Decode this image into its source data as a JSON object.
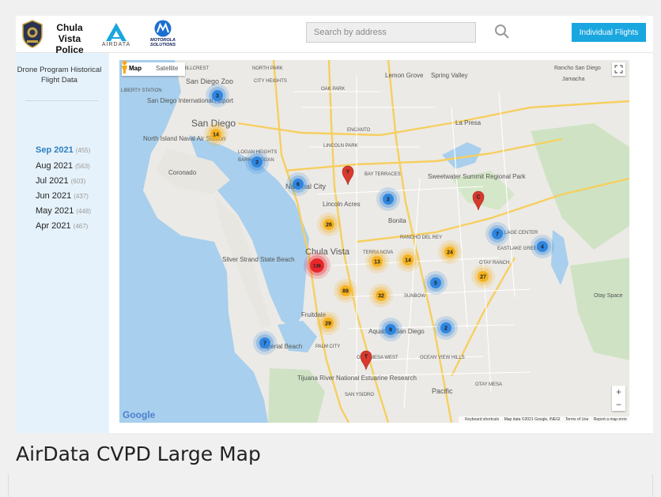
{
  "header": {
    "police_name": "Chula Vista Police",
    "airdata_label": "AIRDATA",
    "moto_label": "MOTOROLA SOLUTIONS",
    "search_placeholder": "Search by address",
    "flights_button": "Individual Flights"
  },
  "sidebar": {
    "title": "Drone Program Historical Flight Data",
    "months": [
      {
        "label": "Sep 2021",
        "count": "(455)",
        "active": true
      },
      {
        "label": "Aug 2021",
        "count": "(563)",
        "active": false
      },
      {
        "label": "Jul 2021",
        "count": "(603)",
        "active": false
      },
      {
        "label": "Jun 2021",
        "count": "(437)",
        "active": false
      },
      {
        "label": "May 2021",
        "count": "(448)",
        "active": false
      },
      {
        "label": "Apr 2021",
        "count": "(467)",
        "active": false
      }
    ]
  },
  "map": {
    "type_map": "Map",
    "type_satellite": "Satellite",
    "google": "Google",
    "attribution": [
      "Keyboard shortcuts",
      "Map data ©2021 Google, INEGI",
      "Terms of Use",
      "Report a map error"
    ],
    "places": [
      "HILLCREST",
      "NORTH PARK",
      "CITY HEIGHTS",
      "OAK PARK",
      "Lemon Grove",
      "Spring Valley",
      "Rancho San Diego",
      "Jamacha",
      "San Diego Zoo",
      "San Diego International Airport",
      "LIBERTY STATION",
      "San Diego",
      "ENCANTO",
      "La Presa",
      "North Island Naval Air Station",
      "LOGAN HEIGHTS",
      "LINCOLN PARK",
      "BARRIO LOGAN",
      "Coronado",
      "National City",
      "BAY TERRACES",
      "Sweetwater Summit Regional Park",
      "Lincoln Acres",
      "Bonita",
      "RANCHO DEL REY",
      "TERRA NOVA",
      "VILLAGE CENTER",
      "EASTLAKE GREENS",
      "Chula Vista",
      "OTAY RANCH",
      "Silver Strand State Beach",
      "SUNBOW",
      "Fruitdale",
      "Aquatica San Diego",
      "Imperial Beach",
      "PALM CITY",
      "OCEAN VIEW HILLS",
      "OTAY MESA WEST",
      "OTAY MESA",
      "Tijuana River National Estuarine Research",
      "SAN YSIDRO",
      "Pacific",
      "Otay Space"
    ],
    "clusters": [
      {
        "label": "3",
        "color": "blue"
      },
      {
        "label": "14",
        "color": "orange"
      },
      {
        "label": "3",
        "color": "blue"
      },
      {
        "label": "6",
        "color": "blue"
      },
      {
        "label": "2",
        "color": "blue"
      },
      {
        "label": "26",
        "color": "orange"
      },
      {
        "label": "7",
        "color": "blue"
      },
      {
        "label": "4",
        "color": "blue"
      },
      {
        "label": "24",
        "color": "orange"
      },
      {
        "label": "14",
        "color": "orange"
      },
      {
        "label": "13",
        "color": "orange"
      },
      {
        "label": "136",
        "color": "red"
      },
      {
        "label": "27",
        "color": "orange"
      },
      {
        "label": "5",
        "color": "blue"
      },
      {
        "label": "89",
        "color": "orange"
      },
      {
        "label": "32",
        "color": "orange"
      },
      {
        "label": "29",
        "color": "orange"
      },
      {
        "label": "9",
        "color": "blue"
      },
      {
        "label": "2",
        "color": "blue"
      },
      {
        "label": "7",
        "color": "blue"
      }
    ],
    "pins": [
      {
        "label": "Y"
      },
      {
        "label": "C"
      },
      {
        "label": "T"
      }
    ]
  },
  "caption": "AirData CVPD Large Map",
  "colors": {
    "accent": "#1aa6df",
    "sidebar_bg": "#e6f2fb",
    "cluster_blue": "#2f86e0",
    "cluster_orange": "#f5b321",
    "cluster_red": "#e8262b",
    "pin_red": "#d83a2d"
  }
}
